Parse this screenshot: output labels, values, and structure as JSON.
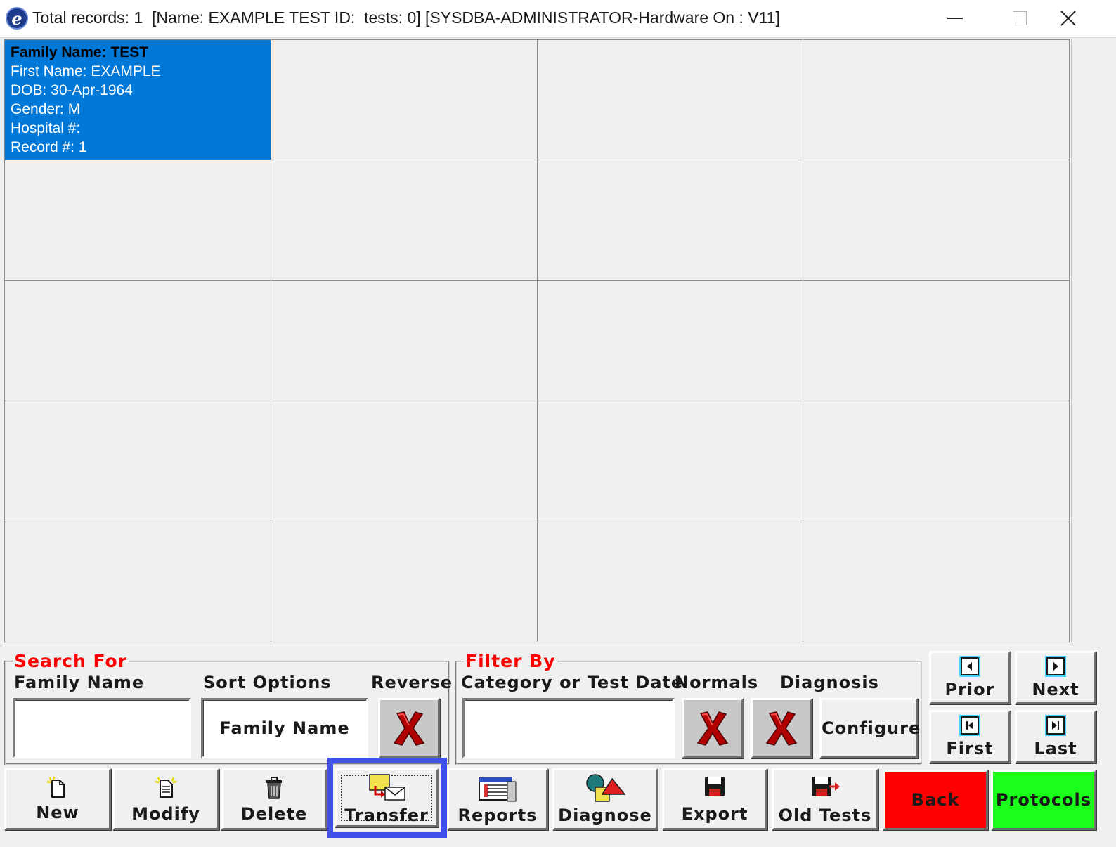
{
  "window": {
    "title": "Total records: 1  [Name: EXAMPLE TEST ID:  tests: 0] [SYSDBA-ADMINISTRATOR-Hardware On : V11]",
    "app_icon_letter": "e"
  },
  "records": [
    {
      "family_name": "Family Name: TEST",
      "first_name": "First Name: EXAMPLE",
      "dob": "DOB: 30-Apr-1964",
      "gender": "Gender: M",
      "hospital": "Hospital #:",
      "record": "Record #: 1"
    }
  ],
  "search": {
    "legend": "Search For",
    "family_name_label": "Family Name",
    "family_name_value": "",
    "sort_label": "Sort Options",
    "sort_value": "Family Name",
    "reverse_label": "Reverse"
  },
  "filter": {
    "legend": "Filter By",
    "category_label": "Category or Test Date",
    "category_value": "",
    "normals_label": "Normals",
    "diagnosis_label": "Diagnosis",
    "configure_label": "Configure"
  },
  "nav": {
    "prior": "Prior",
    "next": "Next",
    "first": "First",
    "last": "Last"
  },
  "toolbar": {
    "new": "New",
    "modify": "Modify",
    "delete": "Delete",
    "transfer": "Transfer",
    "reports": "Reports",
    "diagnose": "Diagnose",
    "export": "Export",
    "old_tests": "Old Tests",
    "back": "Back",
    "protocols": "Protocols"
  },
  "colors": {
    "selected_card": "#0078d7",
    "legend_red": "#ff0000",
    "back_red": "#ff0000",
    "protocols_green": "#1aff1a",
    "focus_blue": "#3f51e8"
  }
}
